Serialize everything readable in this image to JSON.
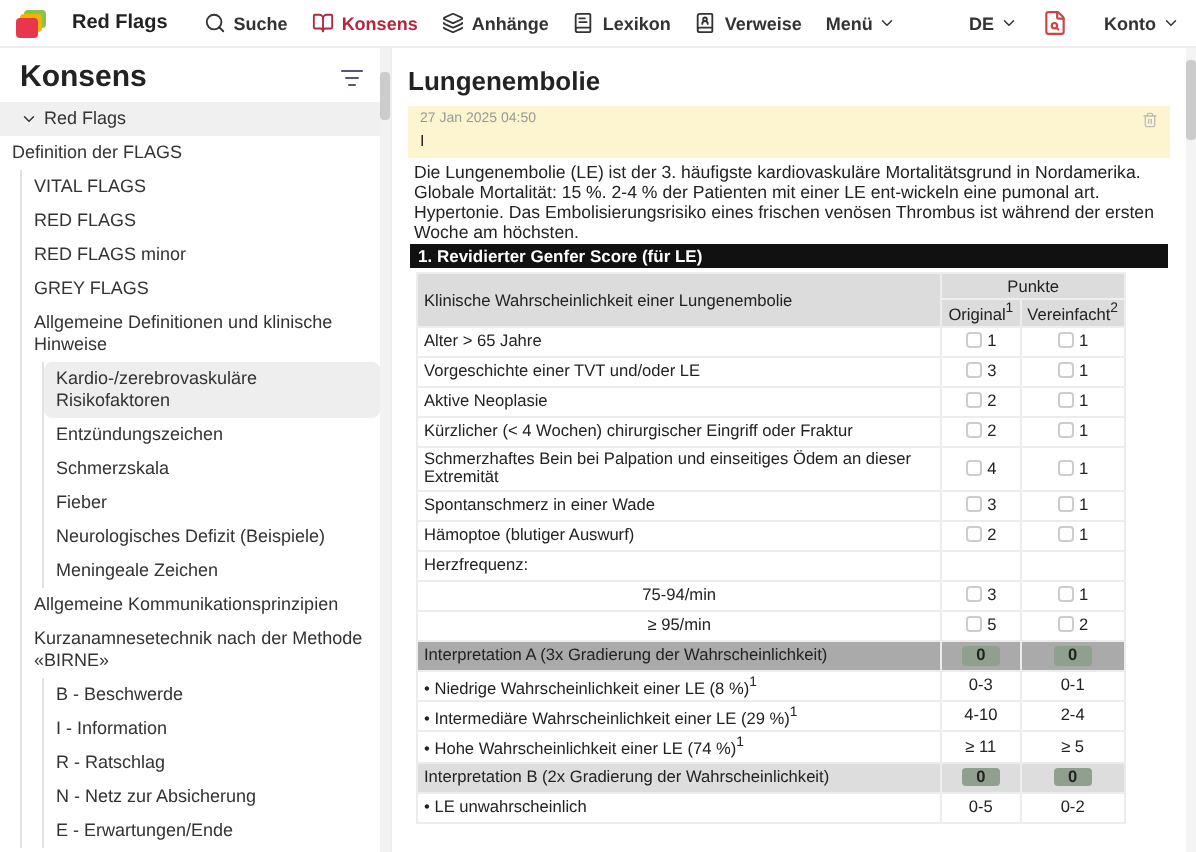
{
  "header": {
    "brand": "Red Flags",
    "nav": [
      {
        "label": "Suche",
        "selected": false
      },
      {
        "label": "Konsens",
        "selected": true
      },
      {
        "label": "Anhänge",
        "selected": false
      },
      {
        "label": "Lexikon",
        "selected": false
      },
      {
        "label": "Verweise",
        "selected": false
      }
    ],
    "menu": "Menü",
    "language": "DE",
    "account": "Konto"
  },
  "sidebar": {
    "title": "Konsens",
    "tree": [
      {
        "label": "Red Flags",
        "expanded": true,
        "selected": false,
        "children": [
          {
            "label": "Definition der FLAGS",
            "selected": false,
            "children": [
              {
                "label": "VITAL FLAGS",
                "selected": false
              },
              {
                "label": "RED FLAGS",
                "selected": false
              },
              {
                "label": "RED FLAGS minor",
                "selected": false
              },
              {
                "label": "GREY FLAGS",
                "selected": false
              },
              {
                "label": "Allgemeine Definitionen und klinische Hinweise",
                "selected": false,
                "children": [
                  {
                    "label": "Kardio-/zerebrovaskuläre Risikofaktoren",
                    "selected": true
                  },
                  {
                    "label": "Entzündungszeichen",
                    "selected": false
                  },
                  {
                    "label": "Schmerzskala",
                    "selected": false
                  },
                  {
                    "label": "Fieber",
                    "selected": false
                  },
                  {
                    "label": "Neurologisches Defizit (Beispiele)",
                    "selected": false
                  },
                  {
                    "label": "Meningeale Zeichen",
                    "selected": false
                  }
                ]
              },
              {
                "label": "Allgemeine Kommunikationsprinzipien",
                "selected": false
              },
              {
                "label": "Kurzanamnesetechnik nach der Methode «BIRNE»",
                "selected": false,
                "children": [
                  {
                    "label": "B - Beschwerde",
                    "selected": false
                  },
                  {
                    "label": "I - Information",
                    "selected": false
                  },
                  {
                    "label": "R - Ratschlag",
                    "selected": false
                  },
                  {
                    "label": "N - Netz zur Absicherung",
                    "selected": false
                  },
                  {
                    "label": "E - Erwartungen/Ende",
                    "selected": false
                  }
                ]
              }
            ]
          }
        ]
      }
    ]
  },
  "article": {
    "title": "Lungenembolie",
    "note": {
      "date": "27 Jan 2025 04:50",
      "text": "I"
    },
    "intro": "Die Lungenembolie (LE) ist der 3. häufigste kardiovaskuläre Mortalitätsgrund in Nordamerika. Globale Mortalität: 15 %. 2-4 % der Patienten mit einer LE ent-wickeln eine pumonal art. Hypertonie. Das Embolisierungsrisiko eines frischen venösen Thrombus ist während der ersten Woche am höchsten.",
    "section": "1. Revidierter Genfer Score (für LE)",
    "table": {
      "label": "Klinische Wahrscheinlichkeit einer Lungenembolie",
      "group": "Punkte",
      "columns": [
        "Original$^{1}$",
        "Vereinfacht$^{2}$"
      ],
      "rows": [
        {
          "kind": "item",
          "label": "Alter > 65 Jahre",
          "values": [
            {
              "points": "1",
              "checked": false
            },
            {
              "points": "1",
              "checked": false
            }
          ]
        },
        {
          "kind": "item",
          "label": "Vorgeschichte einer TVT und/oder LE",
          "values": [
            {
              "points": "3",
              "checked": false
            },
            {
              "points": "1",
              "checked": false
            }
          ]
        },
        {
          "kind": "item",
          "label": "Aktive Neoplasie",
          "values": [
            {
              "points": "2",
              "checked": false
            },
            {
              "points": "1",
              "checked": false
            }
          ]
        },
        {
          "kind": "item",
          "label": "Kürzlicher (< 4 Wochen) chirurgischer Eingriff oder Fraktur",
          "values": [
            {
              "points": "2",
              "checked": false
            },
            {
              "points": "1",
              "checked": false
            }
          ]
        },
        {
          "kind": "item",
          "label": "Schmerzhaftes Bein bei Palpation und einseitiges Ödem an dieser Extremität",
          "values": [
            {
              "points": "4",
              "checked": false
            },
            {
              "points": "1",
              "checked": false
            }
          ]
        },
        {
          "kind": "item",
          "label": "Spontanschmerz in einer Wade",
          "values": [
            {
              "points": "3",
              "checked": false
            },
            {
              "points": "1",
              "checked": false
            }
          ]
        },
        {
          "kind": "item",
          "label": "Hämoptoe (blutiger Auswurf)",
          "values": [
            {
              "points": "2",
              "checked": false
            },
            {
              "points": "1",
              "checked": false
            }
          ]
        },
        {
          "kind": "heading",
          "label": "Herzfrequenz:"
        },
        {
          "kind": "subitem",
          "label": "75-94/min",
          "values": [
            {
              "points": "3",
              "checked": false
            },
            {
              "points": "1",
              "checked": false
            }
          ]
        },
        {
          "kind": "subitem",
          "label": "≥ 95/min",
          "values": [
            {
              "points": "5",
              "checked": false
            },
            {
              "points": "2",
              "checked": false
            }
          ]
        },
        {
          "kind": "total",
          "label": "Interpretation A (3x Gradierung der Wahrscheinlichkeit)",
          "scores": [
            "0",
            "0"
          ]
        },
        {
          "kind": "range",
          "label": "• Niedrige Wahrscheinlichkeit einer LE (8 %)$^{1}$",
          "values": [
            "0-3",
            "0-1"
          ]
        },
        {
          "kind": "range",
          "label": "• Intermediäre Wahrscheinlichkeit einer LE (29 %)$^{1}$",
          "values": [
            "4-10",
            "2-4"
          ]
        },
        {
          "kind": "range",
          "label": "• Hohe Wahrscheinlichkeit einer LE (74 %)$^{1}$",
          "values": [
            "≥ 11",
            "≥ 5"
          ]
        },
        {
          "kind": "subtotal",
          "label": "Interpretation B (2x Gradierung der Wahrscheinlichkeit)",
          "scores": [
            "0",
            "0"
          ]
        },
        {
          "kind": "range",
          "label": "• LE unwahrscheinlich",
          "values": [
            "0-5",
            "0-2"
          ]
        }
      ]
    }
  }
}
